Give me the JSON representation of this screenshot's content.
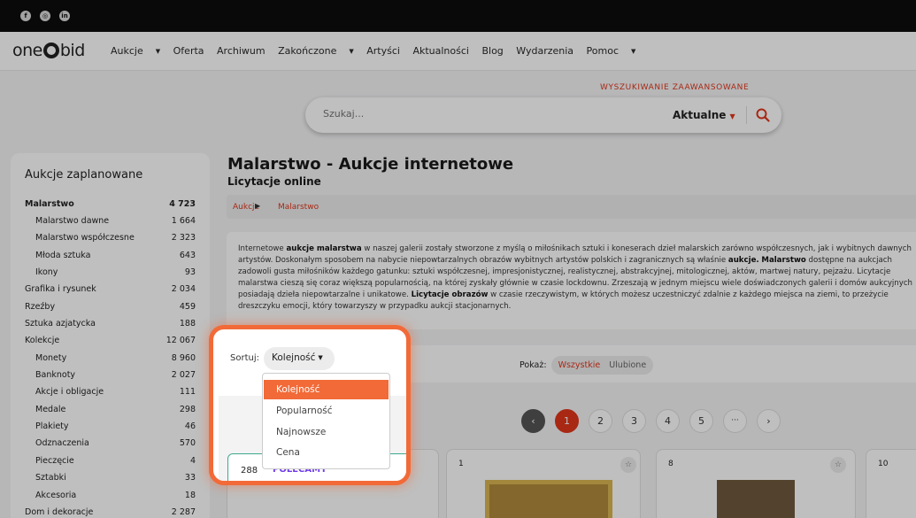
{
  "colors": {
    "accent": "#e1361b",
    "highlight": "#f26a38",
    "recommended": "#6f3de8"
  },
  "social": [
    "facebook-icon",
    "instagram-icon",
    "linkedin-icon"
  ],
  "brand": {
    "left": "one",
    "right": "bid"
  },
  "nav": {
    "items": [
      "Aukcje",
      "Oferta",
      "Archiwum",
      "Zakończone",
      "Artyści",
      "Aktualności",
      "Blog",
      "Wydarzenia",
      "Pomoc"
    ]
  },
  "search": {
    "advanced": "WYSZUKIWANIE ZAAWANSOWANE",
    "placeholder": "Szukaj...",
    "scope": "Aktualne"
  },
  "sidebar": {
    "heading": "Aukcje zaplanowane",
    "items": [
      {
        "label": "Malarstwo",
        "count": "4 723"
      },
      {
        "label": "Malarstwo dawne",
        "count": "1 664"
      },
      {
        "label": "Malarstwo współczesne",
        "count": "2 323"
      },
      {
        "label": "Młoda sztuka",
        "count": "643"
      },
      {
        "label": "Ikony",
        "count": "93"
      },
      {
        "label": "Grafika i rysunek",
        "count": "2 034"
      },
      {
        "label": "Rzeźby",
        "count": "459"
      },
      {
        "label": "Sztuka azjatycka",
        "count": "188"
      },
      {
        "label": "Kolekcje",
        "count": "12 067"
      },
      {
        "label": "Monety",
        "count": "8 960"
      },
      {
        "label": "Banknoty",
        "count": "2 027"
      },
      {
        "label": "Akcje i obligacje",
        "count": "111"
      },
      {
        "label": "Medale",
        "count": "298"
      },
      {
        "label": "Plakiety",
        "count": "46"
      },
      {
        "label": "Odznaczenia",
        "count": "570"
      },
      {
        "label": "Pieczęcie",
        "count": "4"
      },
      {
        "label": "Sztabki",
        "count": "33"
      },
      {
        "label": "Akcesoria",
        "count": "18"
      },
      {
        "label": "Dom i dekoracje",
        "count": "2 287"
      }
    ]
  },
  "page": {
    "title": "Malarstwo - Aukcje internetowe",
    "subtitle": "Licytacje online",
    "breadcrumb": [
      "Aukcje",
      "Malarstwo"
    ]
  },
  "description": {
    "l1a": "Internetowe ",
    "l1b": "aukcje malarstwa",
    "l1c": " w naszej galerii zostały stworzone z myślą o miłośnikach sztuki i koneserach dzieł malarskich zarówno współczesnych, jak i wybitnych dawnych",
    "l2a": "artystów. Doskonałym sposobem na nabycie niepowtarzalnych obrazów wybitnych artystów polskich i zagranicznych są właśnie ",
    "l2b": "aukcje.",
    "l2c": " ",
    "l2d": "Malarstwo",
    "l2e": " dostępne na aukcjach",
    "l3": "zadowoli gusta miłośników każdego gatunku: sztuki współczesnej, impresjonistycznej, realistycznej, abstrakcyjnej, mitologicznej, aktów, martwej natury, pejzażu. Licytacje",
    "l4": "malarstwa cieszą się coraz większą popularnością, na której zyskały głównie w czasie lockdownu. Zrzeszają w jednym miejscu wiele doświadczonych galerii i domów aukcyjnych",
    "l5a": "posiadają dzieła niepowtarzalne i unikatowe. ",
    "l5b": "Licytacje obrazów",
    "l5c": " w czasie rzeczywistym, w których możesz uczestniczyć zdalnie z każdego miejsca na ziemi, to przeżycie",
    "l6": "dreszczyku emocji, który towarzyszy w przypadku aukcji stacjonarnych."
  },
  "sort": {
    "label": "Sortuj:",
    "selected": "Kolejność",
    "options": [
      "Kolejność",
      "Popularność",
      "Najnowsze",
      "Cena"
    ]
  },
  "show": {
    "label": "Pokaż:",
    "all": "Wszystkie",
    "favorites": "Ulubione"
  },
  "pagination": {
    "pages": [
      "1",
      "2",
      "3",
      "4",
      "5"
    ],
    "more": "···",
    "current": "1"
  },
  "cards": [
    {
      "count": "288",
      "badge": "POLECAMY"
    },
    {
      "number": "1"
    },
    {
      "number": "8"
    },
    {
      "number": "10"
    }
  ]
}
